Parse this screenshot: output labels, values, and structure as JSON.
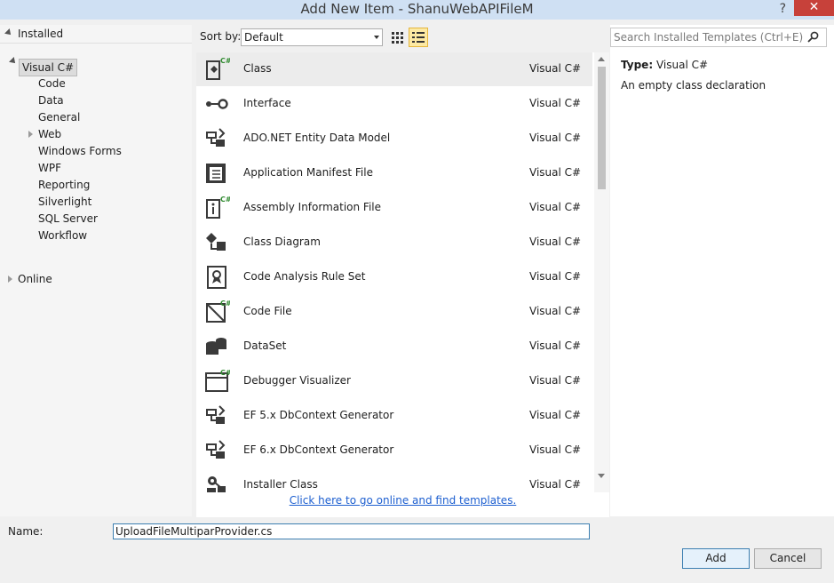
{
  "window": {
    "title": "Add New Item - ShanuWebAPIFileM",
    "help": "?",
    "close": "✕"
  },
  "tree": {
    "header": "Installed",
    "selected": "Visual C#",
    "children": [
      "Code",
      "Data",
      "General",
      "Web",
      "Windows Forms",
      "WPF",
      "Reporting",
      "Silverlight",
      "SQL Server",
      "Workflow"
    ],
    "online": "Online"
  },
  "sort": {
    "label": "Sort by:",
    "value": "Default"
  },
  "templates": [
    {
      "name": "Class",
      "lang": "Visual C#",
      "icon": "class-icon"
    },
    {
      "name": "Interface",
      "lang": "Visual C#",
      "icon": "interface-icon"
    },
    {
      "name": "ADO.NET Entity Data Model",
      "lang": "Visual C#",
      "icon": "entity-model-icon"
    },
    {
      "name": "Application Manifest File",
      "lang": "Visual C#",
      "icon": "manifest-icon"
    },
    {
      "name": "Assembly Information File",
      "lang": "Visual C#",
      "icon": "assembly-info-icon"
    },
    {
      "name": "Class Diagram",
      "lang": "Visual C#",
      "icon": "class-diagram-icon"
    },
    {
      "name": "Code Analysis Rule Set",
      "lang": "Visual C#",
      "icon": "rule-set-icon"
    },
    {
      "name": "Code File",
      "lang": "Visual C#",
      "icon": "code-file-icon"
    },
    {
      "name": "DataSet",
      "lang": "Visual C#",
      "icon": "dataset-icon"
    },
    {
      "name": "Debugger Visualizer",
      "lang": "Visual C#",
      "icon": "debugger-visualizer-icon"
    },
    {
      "name": "EF 5.x DbContext Generator",
      "lang": "Visual C#",
      "icon": "ef-generator-icon"
    },
    {
      "name": "EF 6.x DbContext Generator",
      "lang": "Visual C#",
      "icon": "ef-generator-icon"
    },
    {
      "name": "Installer Class",
      "lang": "Visual C#",
      "icon": "installer-class-icon"
    }
  ],
  "online_link": "Click here to go online and find templates.",
  "search": {
    "placeholder": "Search Installed Templates (Ctrl+E)"
  },
  "details": {
    "type_label": "Type:",
    "type_value": "Visual C#",
    "description": "An empty class declaration"
  },
  "name_field": {
    "label": "Name:",
    "value": "UploadFileMultiparProvider.cs"
  },
  "buttons": {
    "add": "Add",
    "cancel": "Cancel"
  }
}
